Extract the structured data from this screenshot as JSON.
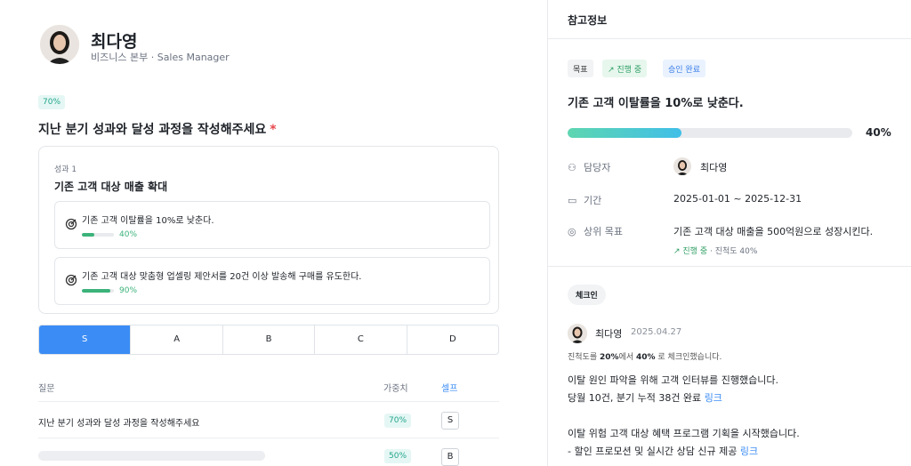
{
  "profile": {
    "name": "최다영",
    "dept": "비즈니스 본부 · Sales Manager"
  },
  "progress_badge": "70%",
  "question": {
    "title": "지난 분기 성과와 달성 과정을 작성해주세요",
    "required_mark": "*"
  },
  "outcome_card": {
    "sub": "성과 1",
    "title": "기존 고객 대상 매출 확대",
    "key_results": [
      {
        "title": "기존 고객 이탈률을 10%로 낮춘다.",
        "percent_label": "40%",
        "progress": 0.4
      },
      {
        "title": "기존 고객 대상 맞춤형 업셀링 제안서를 20건 이상 발송해 구매를 유도한다.",
        "percent_label": "90%",
        "progress": 0.9
      }
    ]
  },
  "grades": [
    "S",
    "A",
    "B",
    "C",
    "D"
  ],
  "selected_grade": "S",
  "table": {
    "headers": {
      "question": "질문",
      "weight": "가중치",
      "self": "셀프"
    },
    "rows": [
      {
        "question": "지난 분기 성과와 달성 과정을 작성해주세요",
        "weight": "70%",
        "self": "S"
      },
      {
        "question": "",
        "weight": "50%",
        "self": "B"
      }
    ]
  },
  "panel": {
    "title": "참고정보",
    "tags": {
      "goal": "목표",
      "status": "진행 중",
      "approval": "승인 완료"
    },
    "objective": "기존 고객 이탈률을 10%로 낮춘다.",
    "progress_label": "40%",
    "progress": 0.4,
    "owner_label": "담당자",
    "owner_name": "최다영",
    "period_label": "기간",
    "period_value": "2025-01-01 ~ 2025-12-31",
    "parent_label": "상위 목표",
    "parent_value": "기존 고객 대상 매출을 500억원으로 성장시킨다.",
    "parent_status": "진행 중",
    "parent_progress_text": "· 진척도 40%"
  },
  "checkin": {
    "label": "체크인",
    "author": "최다영",
    "date": "2025.04.27",
    "note_prefix": "진척도를",
    "note_from": "20%",
    "note_mid": "에서",
    "note_to": "40%",
    "note_suffix": "로 체크인했습니다.",
    "line1": "이탈 원인 파악을 위해 고객 인터뷰를 진행했습니다.",
    "line2": "당월 10건, 분기 누적 38건 완료",
    "line2_link": "링크",
    "line3": "이탈 위험 고객 대상 혜택 프로그램 기획을 시작했습니다.",
    "line4": "- 할인 프로모션 및 실시간 상담 신규 제공",
    "line4_link": "링크"
  },
  "colors": {
    "accent": "#3b8cf5",
    "green": "#3bb27a",
    "teal": "#22a58c"
  }
}
